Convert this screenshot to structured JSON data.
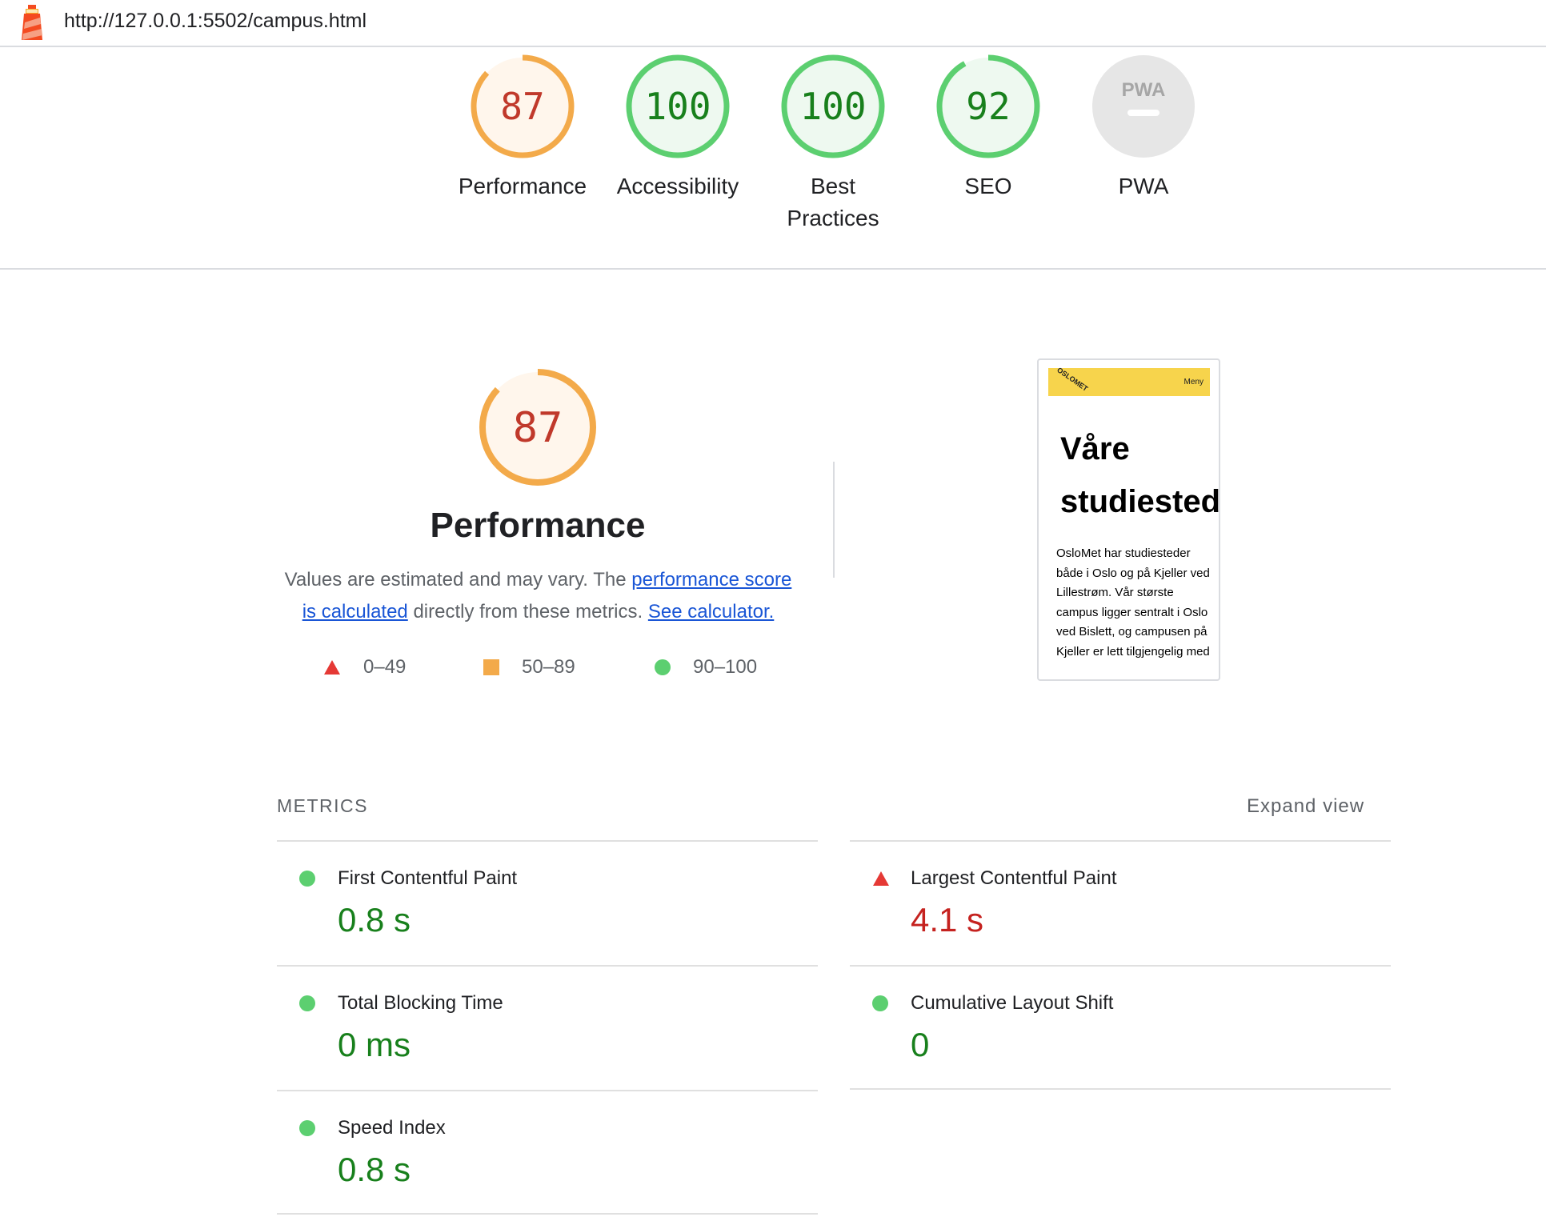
{
  "browser": {
    "url": "http://127.0.0.1:5502/campus.html",
    "logo_icon": "lighthouse-icon"
  },
  "scores": [
    {
      "id": "performance",
      "score": "87",
      "label": "Performance",
      "fraction": 0.87,
      "color": "#e67700",
      "ring": "#f3aa4a",
      "bg": "#fff6ec"
    },
    {
      "id": "accessibility",
      "score": "100",
      "label": "Accessibility",
      "fraction": 1.0,
      "color": "#18801c",
      "ring": "#5ccf70",
      "bg": "#eef9f0"
    },
    {
      "id": "best-practices",
      "score": "100",
      "label": "Best Practices",
      "fraction": 1.0,
      "color": "#18801c",
      "ring": "#5ccf70",
      "bg": "#eef9f0"
    },
    {
      "id": "seo",
      "score": "92",
      "label": "SEO",
      "fraction": 0.92,
      "color": "#18801c",
      "ring": "#5ccf70",
      "bg": "#eef9f0"
    },
    {
      "id": "pwa",
      "score": "PWA",
      "label": "PWA",
      "fraction": 0,
      "color": "#9e9e9e",
      "ring": "#e0e0e0",
      "bg": "#e6e6e6"
    }
  ],
  "performance": {
    "score": "87",
    "title": "Performance",
    "desc_prefix": "Values are estimated and may vary. The ",
    "desc_link1": "performance score is calculated",
    "desc_middle": " directly from these metrics. ",
    "desc_link2": "See calculator.",
    "legend": [
      {
        "shape": "triangle",
        "range": "0–49",
        "color": "#e53935"
      },
      {
        "shape": "square",
        "range": "50–89",
        "color": "#f3aa4a"
      },
      {
        "shape": "circle",
        "range": "90–100",
        "color": "#5ccf70"
      }
    ]
  },
  "screenshot": {
    "logo": "OSLOMET",
    "menu": "Meny",
    "heading_line1": "Våre",
    "heading_line2": "studiested",
    "text": "OsloMet har studiesteder både i Oslo og på Kjeller ved Lillestrøm. Vår største campus ligger sentralt i Oslo ved Bislett, og campusen på Kjeller er lett tilgjengelig med"
  },
  "metrics": {
    "title": "METRICS",
    "expand": "Expand view",
    "items": [
      {
        "label": "First Contentful Paint",
        "value": "0.8 s",
        "status": "good"
      },
      {
        "label": "Largest Contentful Paint",
        "value": "4.1 s",
        "status": "poor"
      },
      {
        "label": "Total Blocking Time",
        "value": "0 ms",
        "status": "good"
      },
      {
        "label": "Cumulative Layout Shift",
        "value": "0",
        "status": "good"
      },
      {
        "label": "Speed Index",
        "value": "0.8 s",
        "status": "good"
      }
    ]
  }
}
